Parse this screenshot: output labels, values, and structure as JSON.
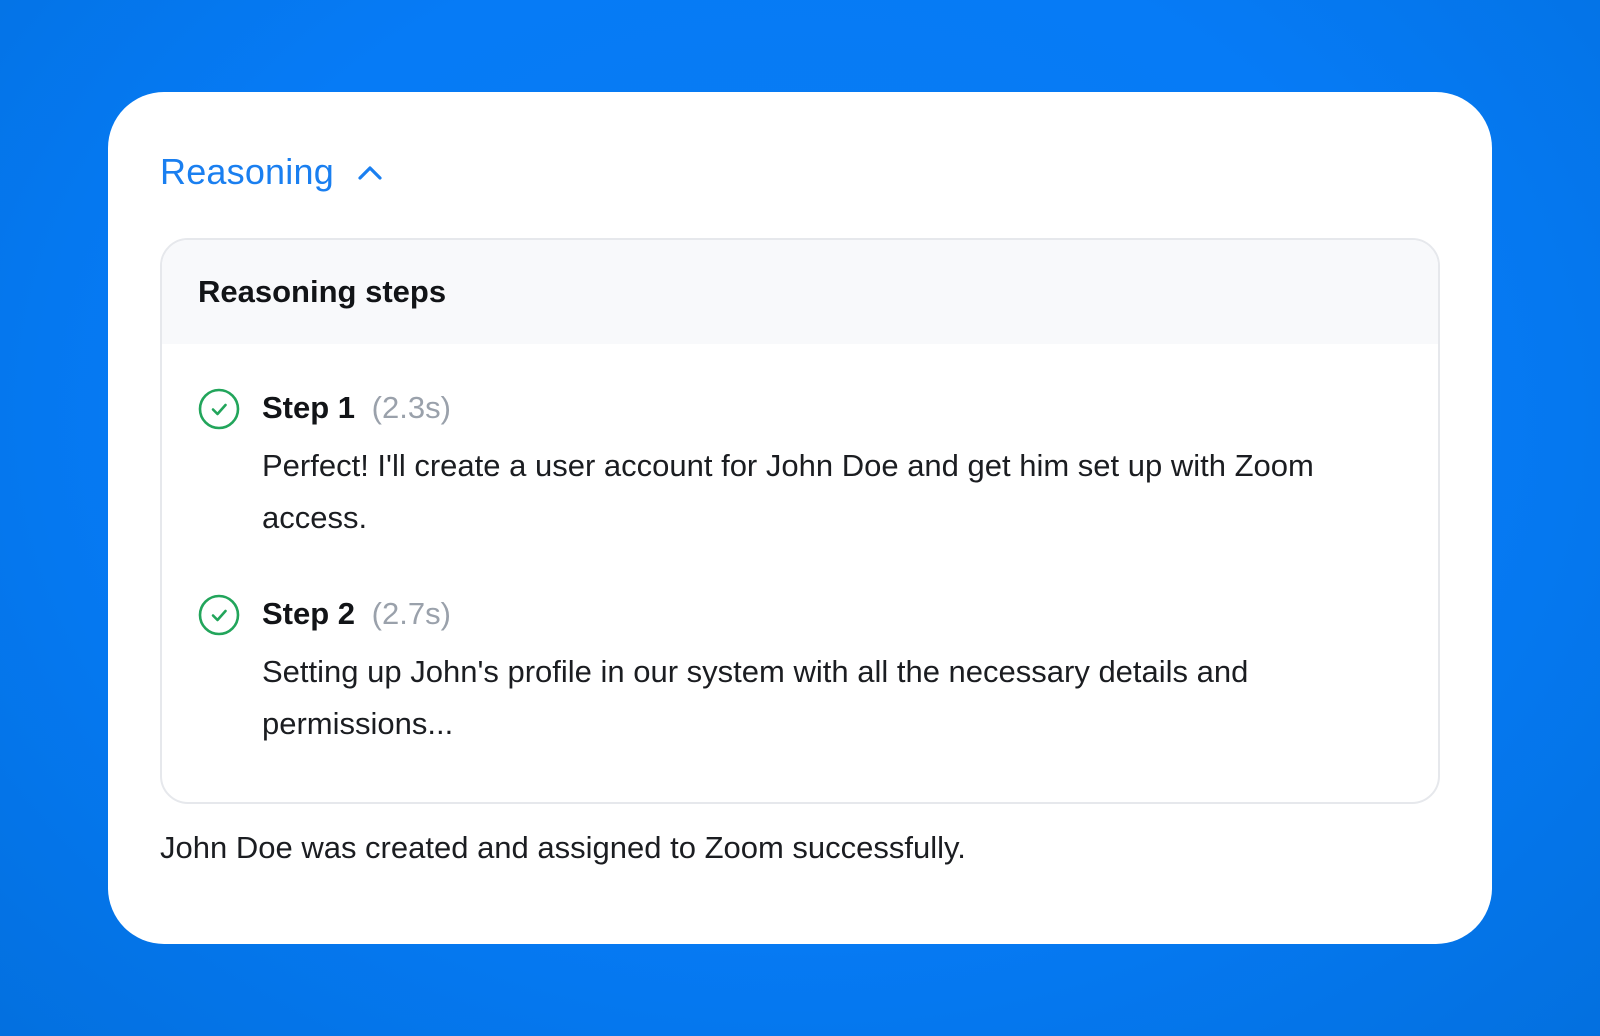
{
  "reasoning_toggle": {
    "label": "Reasoning",
    "icon": "chevron-up-icon",
    "expanded": true
  },
  "panel": {
    "title": "Reasoning steps",
    "steps": [
      {
        "name": "Step 1",
        "duration": "(2.3s)",
        "status_icon": "check-circle-icon",
        "text": "Perfect! I'll create a user account for John Doe and get him set up with Zoom access."
      },
      {
        "name": "Step 2",
        "duration": "(2.7s)",
        "status_icon": "check-circle-icon",
        "text": "Setting up John's profile in our system with all the necessary details and permissions..."
      }
    ]
  },
  "result_message": "John Doe was created and assigned to Zoom successfully.",
  "colors": {
    "background": "#067bf6",
    "accent": "#1a7ff0",
    "success": "#22a55b",
    "muted": "#9aa1ab"
  }
}
